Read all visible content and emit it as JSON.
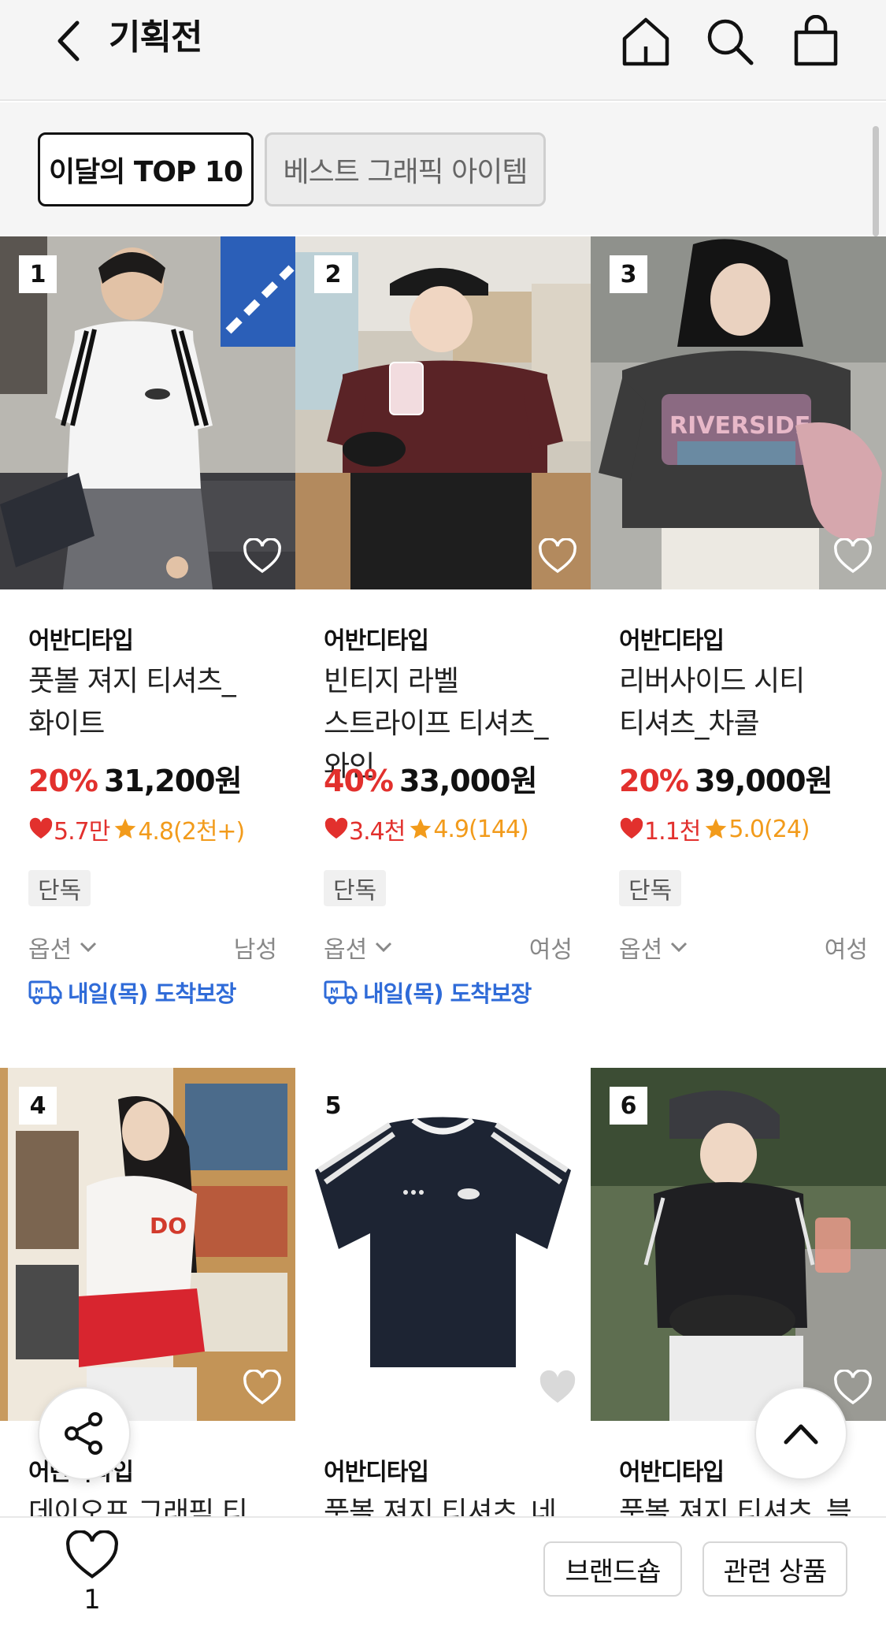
{
  "header": {
    "title": "기획전",
    "back_icon": "back-arrow-icon",
    "icons": [
      "home-icon",
      "search-icon",
      "shopping-bag-icon"
    ]
  },
  "tabs": [
    {
      "label": "이달의 TOP 10",
      "active": true
    },
    {
      "label": "베스트 그래픽 아이템",
      "active": false
    }
  ],
  "products": [
    {
      "rank": "1",
      "brand": "어반디타입",
      "name": "풋볼 져지 티셔츠_화이트",
      "discount": "20%",
      "price": "31,200원",
      "likes": "5.7만",
      "rating": "4.8(2천+)",
      "badge": "단독",
      "option": "옵션",
      "gender": "남성",
      "delivery": "내일(목) 도착보장"
    },
    {
      "rank": "2",
      "brand": "어반디타입",
      "name": "빈티지 라벨 스트라이프 티셔츠_와인",
      "discount": "40%",
      "price": "33,000원",
      "likes": "3.4천",
      "rating": "4.9(144)",
      "badge": "단독",
      "option": "옵션",
      "gender": "여성",
      "delivery": "내일(목) 도착보장"
    },
    {
      "rank": "3",
      "brand": "어반디타입",
      "name": "리버사이드 시티 티셔츠_차콜",
      "discount": "20%",
      "price": "39,000원",
      "likes": "1.1천",
      "rating": "5.0(24)",
      "badge": "단독",
      "option": "옵션",
      "gender": "여성",
      "delivery": ""
    },
    {
      "rank": "4",
      "brand": "어반디타입",
      "name": "데이오프 그래픽 티",
      "liked": true
    },
    {
      "rank": "5",
      "brand": "어반디타입",
      "name": "풋볼 져지 티셔츠_네",
      "liked": false
    },
    {
      "rank": "6",
      "brand": "어반디타입",
      "name": "풋볼 져지 티셔츠_블",
      "liked": true
    }
  ],
  "bottom_bar": {
    "wish_count": "1",
    "brand_shop": "브랜드숍",
    "related": "관련 상품"
  },
  "colors": {
    "discount": "#e2302d",
    "rating": "#f29b1b",
    "delivery": "#2f6bd8"
  }
}
